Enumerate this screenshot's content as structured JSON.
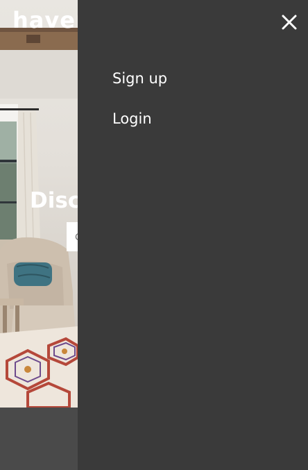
{
  "brand": {
    "name": "haven"
  },
  "hero": {
    "headline": "Discover homes you'll love",
    "search_placeholder": "City, neighborhood or address"
  },
  "menu": {
    "close_icon": "close-icon",
    "items": [
      {
        "label": "Sign up"
      },
      {
        "label": "Login"
      }
    ]
  },
  "colors": {
    "menu_background": "#3a3a3a",
    "footer_background": "#4a4a4a",
    "menu_text": "#ffffff"
  }
}
